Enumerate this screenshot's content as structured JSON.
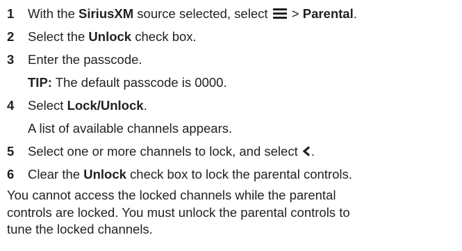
{
  "steps": [
    {
      "number": "1",
      "text_a": "With the ",
      "bold_a": "SiriusXM",
      "text_b": " source selected, select ",
      "icon": "menu-icon",
      "text_c": " > ",
      "bold_b": "Parental",
      "text_d": "."
    },
    {
      "number": "2",
      "text_a": "Select the ",
      "bold_a": "Unlock",
      "text_b": " check box."
    },
    {
      "number": "3",
      "text": "Enter the passcode.",
      "tip_label": "TIP:",
      "tip_text": " The default passcode is 0000."
    },
    {
      "number": "4",
      "text_a": "Select ",
      "bold_a": "Lock/Unlock",
      "text_b": ".",
      "result": "A list of available channels appears."
    },
    {
      "number": "5",
      "text_a": "Select one or more channels to lock, and select ",
      "icon": "back-chevron-icon",
      "text_b": "."
    },
    {
      "number": "6",
      "text_a": "Clear the ",
      "bold_a": "Unlock",
      "text_b": " check box to lock the parental controls."
    }
  ],
  "note": [
    "You cannot access the locked channels while the parental",
    "controls are locked. You must unlock the parental controls to",
    "tune the locked channels."
  ]
}
